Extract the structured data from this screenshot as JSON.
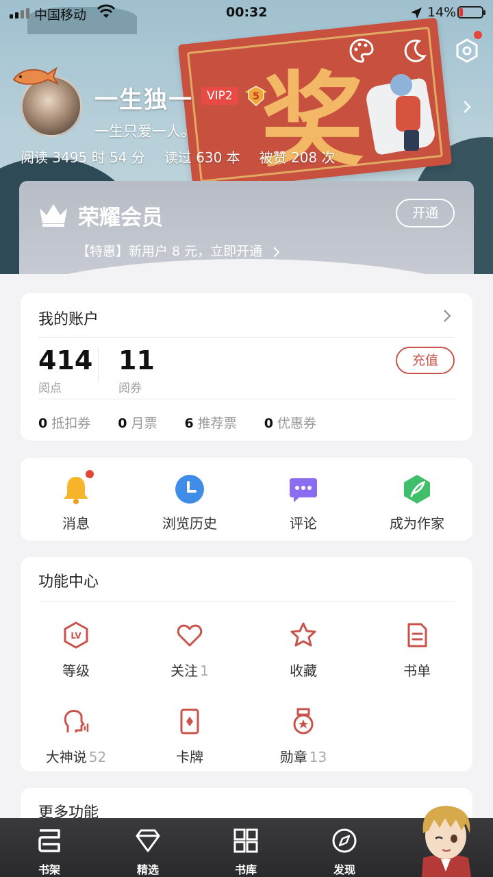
{
  "status_bar": {
    "carrier": "中国移动",
    "time": "00:32",
    "battery": "14%"
  },
  "profile": {
    "name": "一生独一",
    "vip": "VIP2",
    "level": "5",
    "bio": "一生只爱一人。",
    "stats": [
      "阅读 3495 时 54 分",
      "读过 630 本",
      "被赞 208 次"
    ]
  },
  "banner": {
    "char": "奖"
  },
  "member": {
    "title": "荣耀会员",
    "subtitle": "【特惠】新用户 8 元，立即开通",
    "button": "开通"
  },
  "account": {
    "title": "我的账户",
    "points_value": "414",
    "points_label": "阅点",
    "vouchers_value": "11",
    "vouchers_label": "阅券",
    "recharge": "充值",
    "tickets": [
      {
        "count": "0",
        "label": "抵扣券"
      },
      {
        "count": "0",
        "label": "月票"
      },
      {
        "count": "6",
        "label": "推荐票"
      },
      {
        "count": "0",
        "label": "优惠券"
      }
    ]
  },
  "quick": [
    {
      "label": "消息",
      "icon": "bell-icon"
    },
    {
      "label": "浏览历史",
      "icon": "clock-icon"
    },
    {
      "label": "评论",
      "icon": "chat-icon"
    },
    {
      "label": "成为作家",
      "icon": "quill-icon"
    }
  ],
  "functions": {
    "title": "功能中心",
    "items": [
      {
        "label": "等级",
        "count": "",
        "icon": "level-icon"
      },
      {
        "label": "关注",
        "count": "1",
        "icon": "heart-icon"
      },
      {
        "label": "收藏",
        "count": "",
        "icon": "star-icon"
      },
      {
        "label": "书单",
        "count": "",
        "icon": "booklist-icon"
      },
      {
        "label": "大神说",
        "count": "52",
        "icon": "speaker-icon"
      },
      {
        "label": "卡牌",
        "count": "",
        "icon": "card-icon"
      },
      {
        "label": "勋章",
        "count": "13",
        "icon": "medal-icon"
      }
    ]
  },
  "more": {
    "title": "更多功能"
  },
  "tabs": [
    {
      "label": "书架",
      "icon": "bookshelf-icon"
    },
    {
      "label": "精选",
      "icon": "diamond-icon"
    },
    {
      "label": "书库",
      "icon": "grid-icon"
    },
    {
      "label": "发现",
      "icon": "compass-icon"
    }
  ],
  "colors": {
    "accent": "#c9534a",
    "vip_red": "#e84a46",
    "tabbar": "#2e2e30"
  }
}
